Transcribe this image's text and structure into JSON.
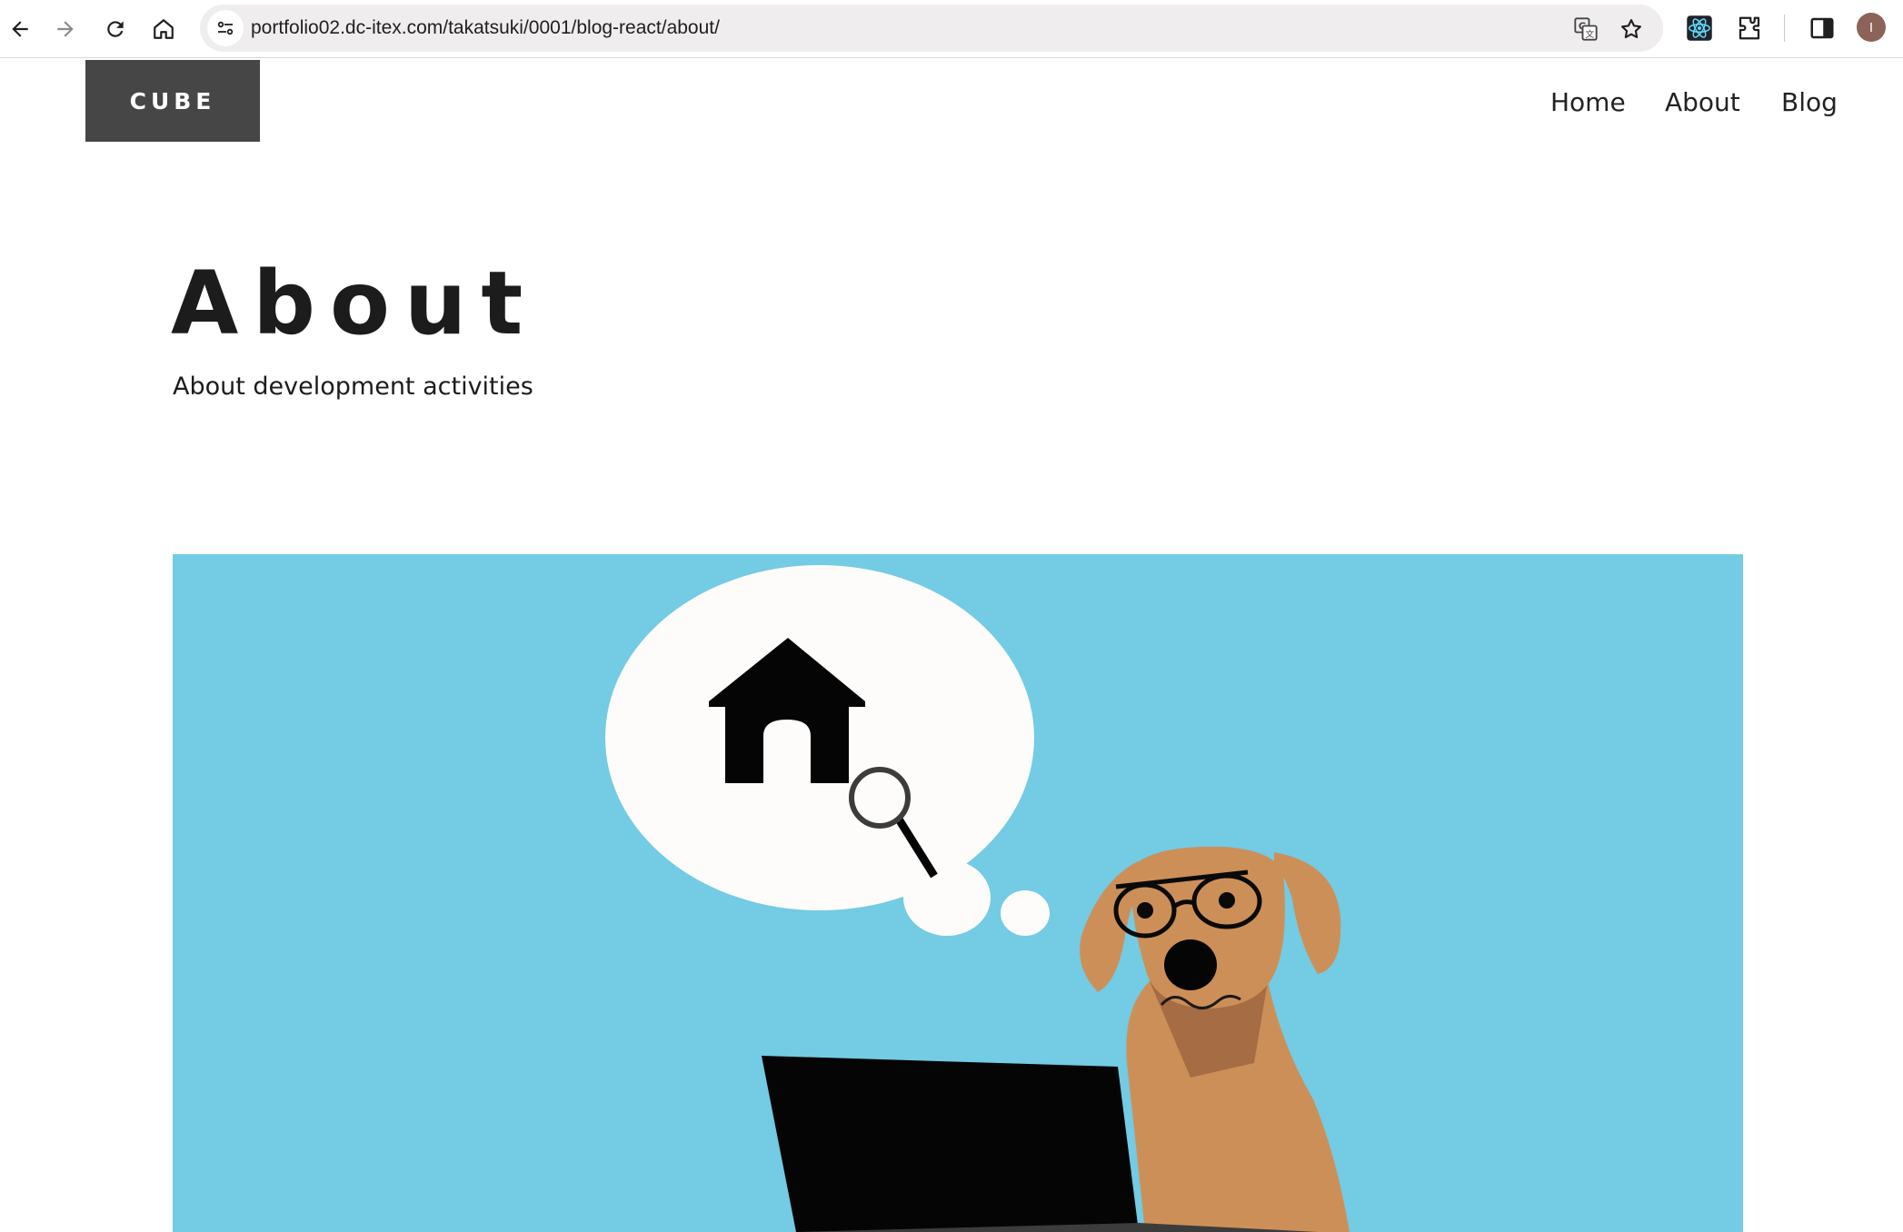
{
  "browser": {
    "url": "portfolio02.dc-itex.com/takatsuki/0001/blog-react/about/",
    "avatar_initial": "I",
    "icons": [
      "back-icon",
      "forward-icon",
      "reload-icon",
      "home-icon",
      "site-settings-icon",
      "translate-icon",
      "bookmark-star-icon",
      "react-devtools-icon",
      "extensions-icon",
      "side-panel-icon"
    ]
  },
  "site": {
    "logo": "CUBE",
    "nav": [
      "Home",
      "About",
      "Blog"
    ]
  },
  "page": {
    "title": "About",
    "subtitle": "About development activities"
  },
  "colors": {
    "logo_bg": "#464646",
    "hero_bg": "#73cbe4",
    "dog": "#cd8f58",
    "dog_shadow": "#a66c44",
    "bubble": "#fdfcfa"
  }
}
